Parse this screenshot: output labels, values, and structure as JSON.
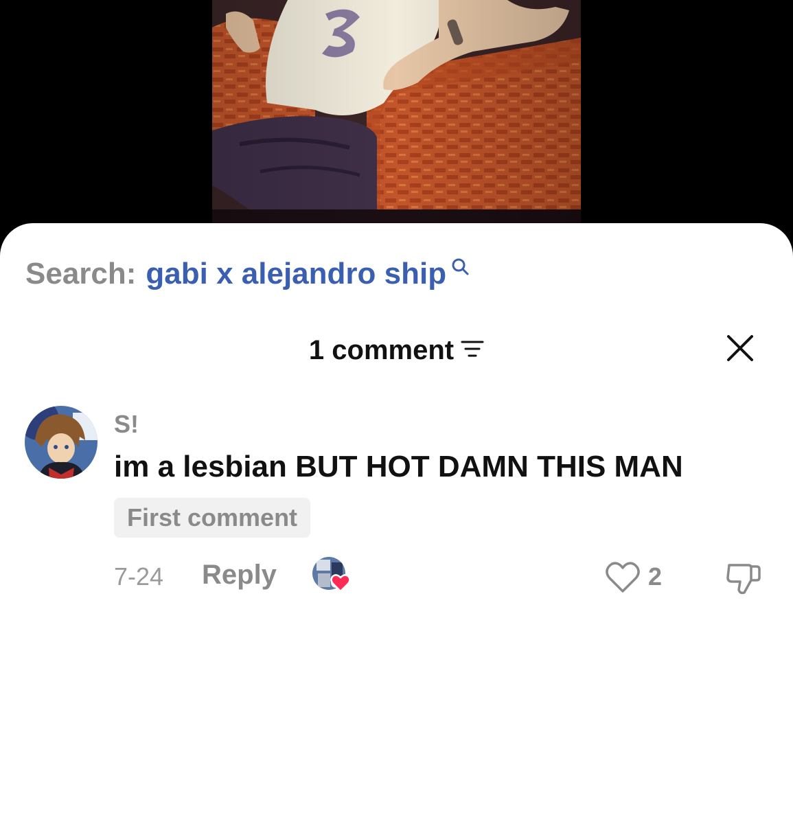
{
  "search": {
    "prefix": "Search:",
    "query": "gabi x alejandro ship",
    "icon": "search-icon"
  },
  "header": {
    "comment_count": "1 comment",
    "sort_icon": "sort-icon",
    "close_icon": "close-icon"
  },
  "comment": {
    "username": "S!",
    "text": "im a lesbian BUT HOT DAMN THIS MAN",
    "badge": "First comment",
    "date": "7-24",
    "reply_label": "Reply",
    "like_count": "2",
    "liked_by_creator": true
  },
  "colors": {
    "accent_blue": "#3b5fb0",
    "muted_gray": "#8a8a8a",
    "heart_red": "#fe2c55"
  }
}
